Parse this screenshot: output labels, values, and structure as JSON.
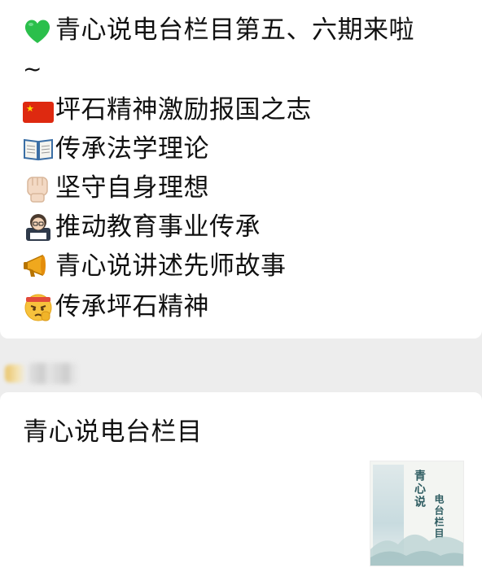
{
  "message1": {
    "title": "青心说电台栏目第五、六期来啦",
    "tilde": "~",
    "items": [
      {
        "icon": "green-heart-icon",
        "text": "坪石精神激励报国之志"
      },
      {
        "icon": "open-book-icon",
        "text": "传承法学理论"
      },
      {
        "icon": "raised-fist-icon",
        "text": "坚守自身理想"
      },
      {
        "icon": "teacher-icon",
        "text": "推动教育事业传承"
      },
      {
        "icon": "megaphone-icon",
        "text": "青心说讲述先师故事"
      },
      {
        "icon": "determined-face-icon",
        "text": "传承坪石精神"
      }
    ],
    "colors": {
      "heart": "#2bbf4b",
      "flag_red": "#de2910",
      "flag_star": "#ffde00"
    }
  },
  "message2": {
    "title": "青心说电台栏目",
    "thumbnail": {
      "title_line1": "青心说",
      "title_line2": "电台栏目"
    }
  }
}
